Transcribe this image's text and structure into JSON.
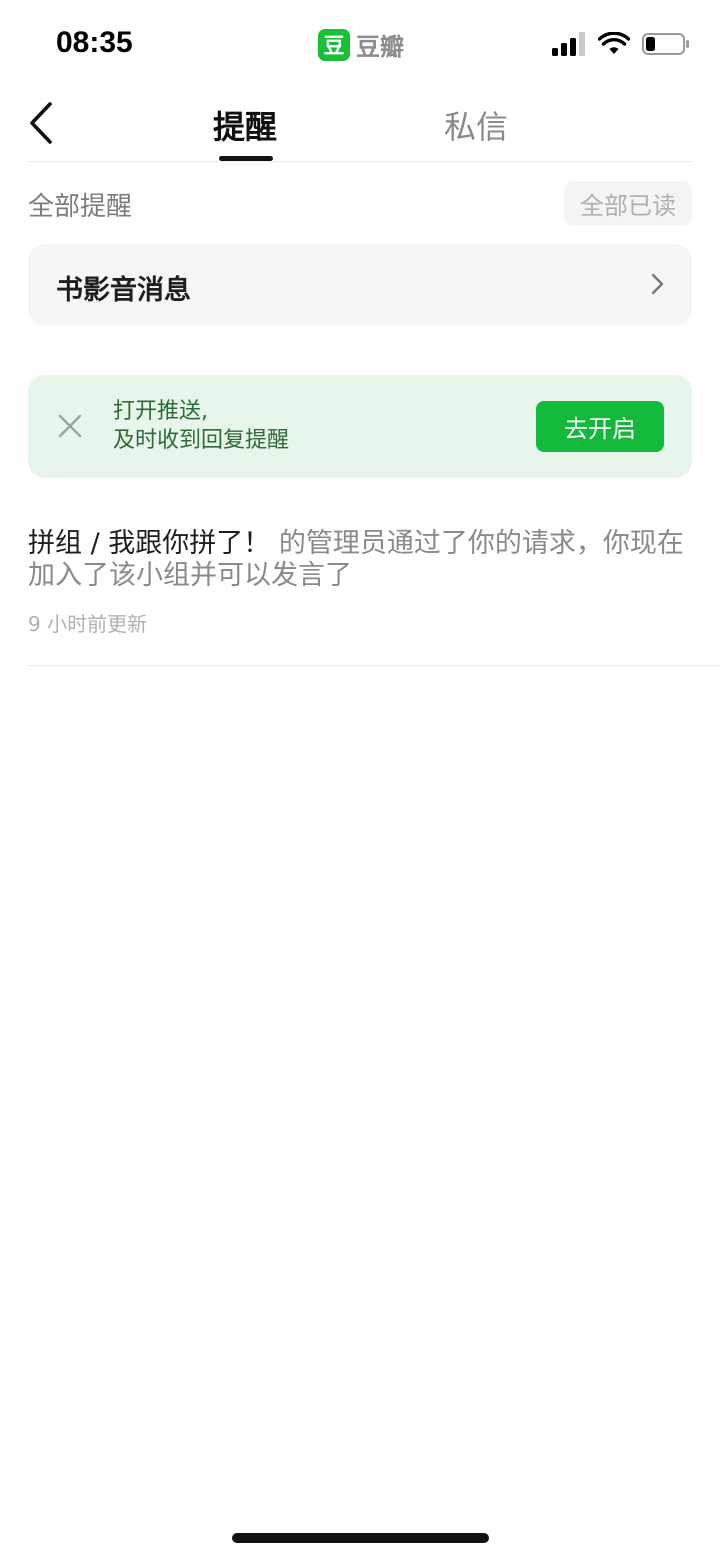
{
  "status_bar": {
    "time": "08:35",
    "app_badge": "豆",
    "app_name": "豆瓣",
    "battery_level": 0.2,
    "signal_bars": 3
  },
  "header": {
    "tabs": [
      {
        "label": "提醒",
        "active": true
      },
      {
        "label": "私信",
        "active": false
      }
    ]
  },
  "section": {
    "title": "全部提醒",
    "mark_all_label": "全部已读"
  },
  "media_card": {
    "label": "书影音消息"
  },
  "push_banner": {
    "line1": "打开推送,",
    "line2": "及时收到回复提醒",
    "button_label": "去开启"
  },
  "notifications": [
    {
      "group": "拼组 / 我跟你拼了！",
      "text": " 的管理员通过了你的请求，你现在加入了该小组并可以发言了",
      "time": "9 小时前更新"
    }
  ],
  "colors": {
    "brand_green": "#19c037",
    "banner_bg": "#e8f5ea",
    "banner_text": "#2f6b3a"
  },
  "icons": [
    "back-icon",
    "close-icon",
    "chevron-right-icon",
    "signal-icon",
    "wifi-icon",
    "battery-icon"
  ]
}
